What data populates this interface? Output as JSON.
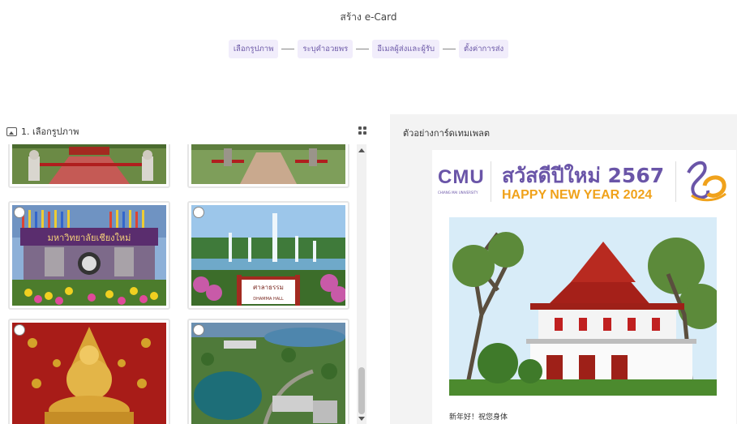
{
  "page": {
    "title": "สร้าง e-Card"
  },
  "steps": [
    "เลือกรูปภาพ",
    "ระบุคำอวยพร",
    "อีเมลผู้ส่งและผู้รับ",
    "ตั้งค่าการส่ง"
  ],
  "left": {
    "heading": "1. เลือกรูปภาพ"
  },
  "gallery": {
    "signs": [
      "มหาวิทยาลัยเชียงใหม่",
      "ศาลาธรรม",
      "DHAMMA HALL"
    ]
  },
  "preview": {
    "heading": "ตัวอย่างการ์ดเทมเพลต",
    "brand": "CMU",
    "brand_sub": "CHIANG MAI UNIVERSITY",
    "greeting_th": "สวัสดีปีใหม่ 2567",
    "greeting_en": "HAPPY NEW YEAR 2024",
    "message": "新年好！祝您身体"
  },
  "colors": {
    "accent": "#6a55a8",
    "gold": "#f0a21b",
    "step_bg": "#f1edfb"
  }
}
